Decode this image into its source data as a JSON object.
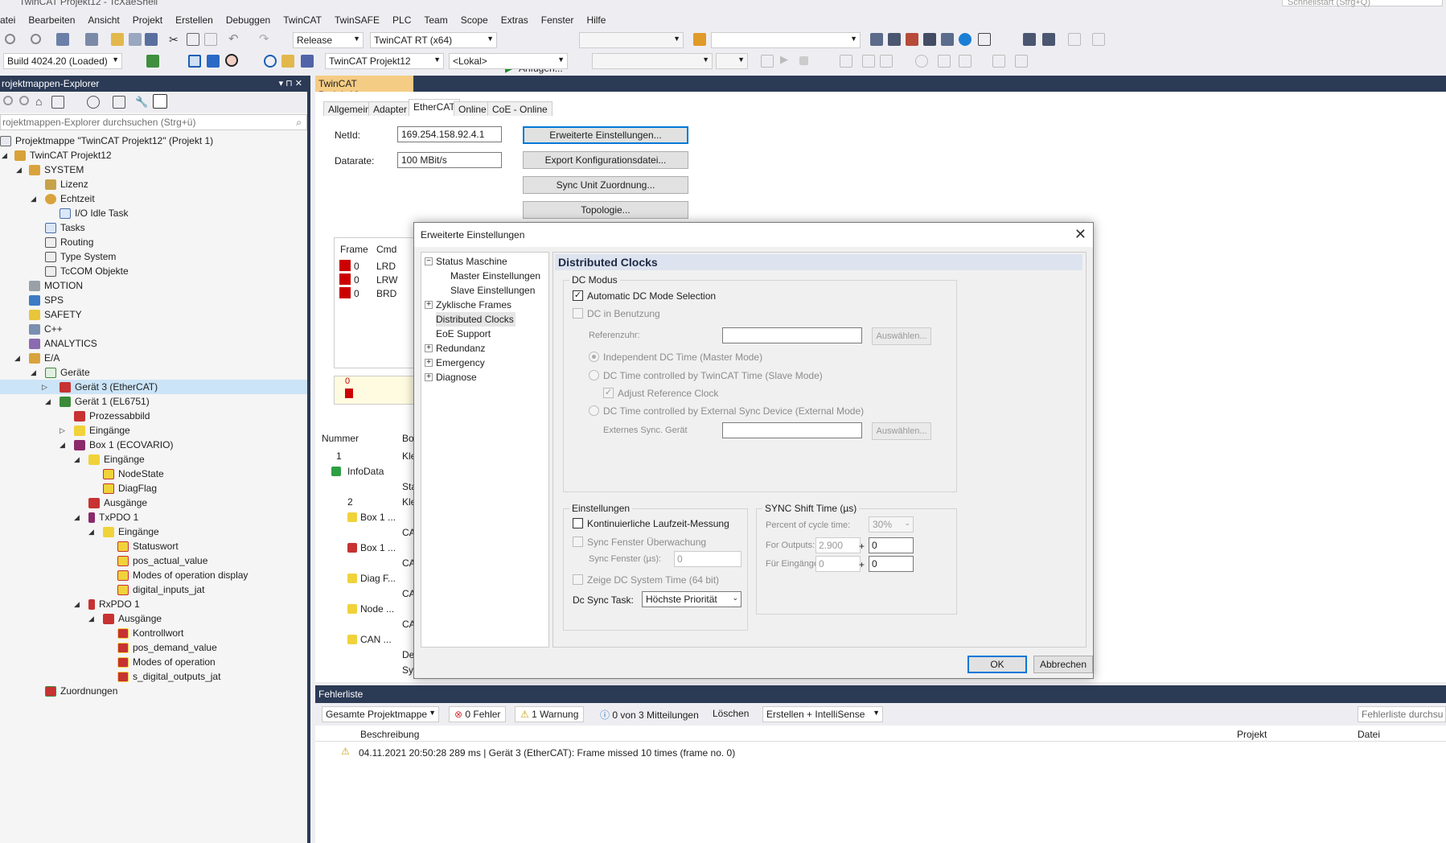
{
  "window": {
    "title": "TwinCAT Projekt12 - TcXaeShell",
    "quick_launch": "Schnellstart (Strg+Q)"
  },
  "menu": [
    "atei",
    "Bearbeiten",
    "Ansicht",
    "Projekt",
    "Erstellen",
    "Debuggen",
    "TwinCAT",
    "TwinSAFE",
    "PLC",
    "Team",
    "Scope",
    "Extras",
    "Fenster",
    "Hilfe"
  ],
  "toolbar": {
    "config": "Release",
    "platform": "TwinCAT RT (x64)",
    "start": "Anfügen...",
    "build": "Build 4024.20 (Loaded)",
    "project": "TwinCAT Projekt12",
    "target": "<Lokal>"
  },
  "explorer": {
    "title": "rojektmappen-Explorer",
    "search": "rojektmappen-Explorer durchsuchen (Strg+ü)",
    "items": [
      {
        "label": "Projektmappe \"TwinCAT Projekt12\" (Projekt 1)"
      },
      {
        "label": "TwinCAT Projekt12"
      },
      {
        "label": "SYSTEM"
      },
      {
        "label": "Lizenz"
      },
      {
        "label": "Echtzeit"
      },
      {
        "label": "I/O Idle Task"
      },
      {
        "label": "Tasks"
      },
      {
        "label": "Routing"
      },
      {
        "label": "Type System"
      },
      {
        "label": "TcCOM Objekte"
      },
      {
        "label": "MOTION"
      },
      {
        "label": "SPS"
      },
      {
        "label": "SAFETY"
      },
      {
        "label": "C++"
      },
      {
        "label": "ANALYTICS"
      },
      {
        "label": "E/A"
      },
      {
        "label": "Geräte"
      },
      {
        "label": "Gerät 3 (EtherCAT)"
      },
      {
        "label": "Gerät 1 (EL6751)"
      },
      {
        "label": "Prozessabbild"
      },
      {
        "label": "Eingänge"
      },
      {
        "label": "Box 1 (ECOVARIO)"
      },
      {
        "label": "Eingänge"
      },
      {
        "label": "NodeState"
      },
      {
        "label": "DiagFlag"
      },
      {
        "label": "Ausgänge"
      },
      {
        "label": "TxPDO 1"
      },
      {
        "label": "Eingänge"
      },
      {
        "label": "Statuswort"
      },
      {
        "label": "pos_actual_value"
      },
      {
        "label": "Modes of operation display"
      },
      {
        "label": "digital_inputs_jat"
      },
      {
        "label": "RxPDO 1"
      },
      {
        "label": "Ausgänge"
      },
      {
        "label": "Kontrollwort"
      },
      {
        "label": "pos_demand_value"
      },
      {
        "label": "Modes of operation"
      },
      {
        "label": "s_digital_outputs_jat"
      },
      {
        "label": "Zuordnungen"
      }
    ]
  },
  "doc": {
    "tab": "TwinCAT Projekt12",
    "subtabs": [
      "Allgemein",
      "Adapter",
      "EtherCAT",
      "Online",
      "CoE - Online"
    ],
    "netid_label": "NetId:",
    "netid": "169.254.158.92.4.1",
    "datarate_label": "Datarate:",
    "datarate": "100 MBit/s",
    "btn_advanced": "Erweiterte Einstellungen...",
    "btn_export": "Export Konfigurationsdatei...",
    "btn_sync": "Sync Unit Zuordnung...",
    "btn_topo": "Topologie...",
    "frame_cols": [
      "Frame",
      "Cmd"
    ],
    "frames": [
      {
        "frame": "0",
        "cmd": "LRD"
      },
      {
        "frame": "0",
        "cmd": "LRW"
      },
      {
        "frame": "0",
        "cmd": "BRD"
      }
    ],
    "yellow_val": "0",
    "list_cols": [
      "Nummer",
      "Bo"
    ],
    "list": [
      {
        "a": "1",
        "b": "Kle"
      },
      {
        "a": "InfoData",
        "b": ""
      },
      {
        "a": "",
        "b": "Sta"
      },
      {
        "a": "2",
        "b": "Kle"
      },
      {
        "a": "Box 1 ...",
        "b": ""
      },
      {
        "a": "",
        "b": "CA"
      },
      {
        "a": "Box 1 ...",
        "b": ""
      },
      {
        "a": "",
        "b": "CA"
      },
      {
        "a": "Diag F...",
        "b": ""
      },
      {
        "a": "",
        "b": "CA"
      },
      {
        "a": "Node ...",
        "b": ""
      },
      {
        "a": "",
        "b": "CA"
      },
      {
        "a": "CAN ...",
        "b": ""
      },
      {
        "a": "",
        "b": "De"
      },
      {
        "a": "",
        "b": "Sy"
      }
    ]
  },
  "dialog": {
    "title": "Erweiterte Einstellungen",
    "tree": [
      "Status Maschine",
      "Master Einstellungen",
      "Slave Einstellungen",
      "Zyklische Frames",
      "Distributed Clocks",
      "EoE Support",
      "Redundanz",
      "Emergency",
      "Diagnose"
    ],
    "section_title": "Distributed Clocks",
    "dc_group": "DC Modus",
    "auto_dc": "Automatic DC Mode Selection",
    "dc_in_use": "DC in Benutzung",
    "ref_clock": "Referenzuhr:",
    "choose": "Auswählen...",
    "indep": "Independent DC Time (Master Mode)",
    "slave_mode": "DC Time controlled by TwinCAT Time (Slave Mode)",
    "adjust": "Adjust Reference Clock",
    "ext_mode": "DC Time controlled by External Sync Device (External Mode)",
    "ext_device": "Externes Sync. Gerät",
    "settings_group": "Einstellungen",
    "cont_meas": "Kontinuierliche Laufzeit-Messung",
    "sync_window": "Sync Fenster Überwachung",
    "sync_window_us": "Sync Fenster (µs):",
    "sync_window_val": "0",
    "show_dc": "Zeige  DC System Time (64 bit)",
    "dc_task_label": "Dc Sync Task:",
    "dc_task": "Höchste Priorität",
    "shift_group": "SYNC Shift Time (µs)",
    "percent_label": "Percent of cycle time:",
    "percent": "30%",
    "outputs_label": "For Outputs:",
    "outputs_val": "2.900",
    "outputs_add": "0",
    "inputs_label": "Für Eingänge:",
    "inputs_val": "0",
    "inputs_add": "0",
    "plus": "+",
    "ok": "OK",
    "cancel": "Abbrechen"
  },
  "errors": {
    "title": "Fehlerliste",
    "scope": "Gesamte Projektmappe",
    "errors": "0 Fehler",
    "warnings": "1 Warnung",
    "messages": "0 von 3 Mitteilungen",
    "clear": "Löschen",
    "filter": "Erstellen + IntelliSense",
    "search": "Fehlerliste durchsu",
    "cols": [
      "Beschreibung",
      "Projekt",
      "Datei"
    ],
    "rows": [
      {
        "desc": "04.11.2021 20:50:28 289 ms | Gerät 3 (EtherCAT): Frame missed 10 times (frame no. 0)"
      }
    ]
  }
}
